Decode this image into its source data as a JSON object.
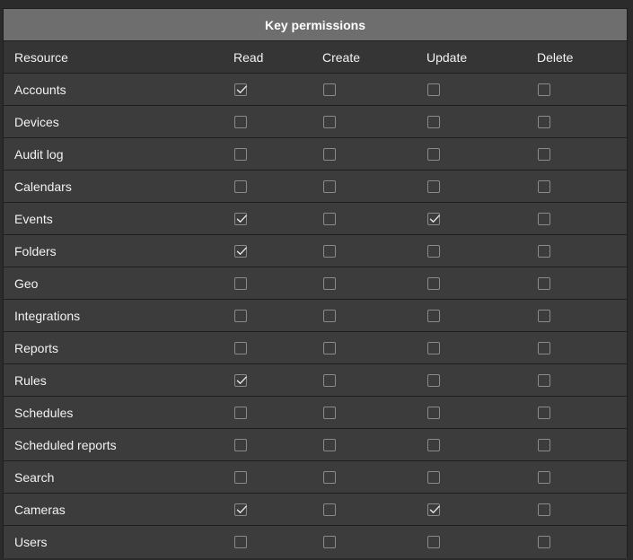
{
  "title": "Key permissions",
  "columns": {
    "resource": "Resource",
    "read": "Read",
    "create": "Create",
    "update": "Update",
    "delete": "Delete"
  },
  "rows": [
    {
      "resource": "Accounts",
      "read": true,
      "create": false,
      "update": false,
      "delete": false
    },
    {
      "resource": "Devices",
      "read": false,
      "create": false,
      "update": false,
      "delete": false
    },
    {
      "resource": "Audit log",
      "read": false,
      "create": false,
      "update": false,
      "delete": false
    },
    {
      "resource": "Calendars",
      "read": false,
      "create": false,
      "update": false,
      "delete": false
    },
    {
      "resource": "Events",
      "read": true,
      "create": false,
      "update": true,
      "delete": false
    },
    {
      "resource": "Folders",
      "read": true,
      "create": false,
      "update": false,
      "delete": false
    },
    {
      "resource": "Geo",
      "read": false,
      "create": false,
      "update": false,
      "delete": false
    },
    {
      "resource": "Integrations",
      "read": false,
      "create": false,
      "update": false,
      "delete": false
    },
    {
      "resource": "Reports",
      "read": false,
      "create": false,
      "update": false,
      "delete": false
    },
    {
      "resource": "Rules",
      "read": true,
      "create": false,
      "update": false,
      "delete": false
    },
    {
      "resource": "Schedules",
      "read": false,
      "create": false,
      "update": false,
      "delete": false
    },
    {
      "resource": "Scheduled reports",
      "read": false,
      "create": false,
      "update": false,
      "delete": false
    },
    {
      "resource": "Search",
      "read": false,
      "create": false,
      "update": false,
      "delete": false
    },
    {
      "resource": "Cameras",
      "read": true,
      "create": false,
      "update": true,
      "delete": false
    },
    {
      "resource": "Users",
      "read": false,
      "create": false,
      "update": false,
      "delete": false
    }
  ],
  "icons": {
    "check": "check-icon"
  },
  "colors": {
    "title_bar": "#6e6e6e",
    "header_bg": "#353535",
    "row_bg": "#3c3c3c",
    "page_bg": "#2b2b2b",
    "checkbox_border": "#8a8a8a",
    "text": "#f2f2f2"
  }
}
